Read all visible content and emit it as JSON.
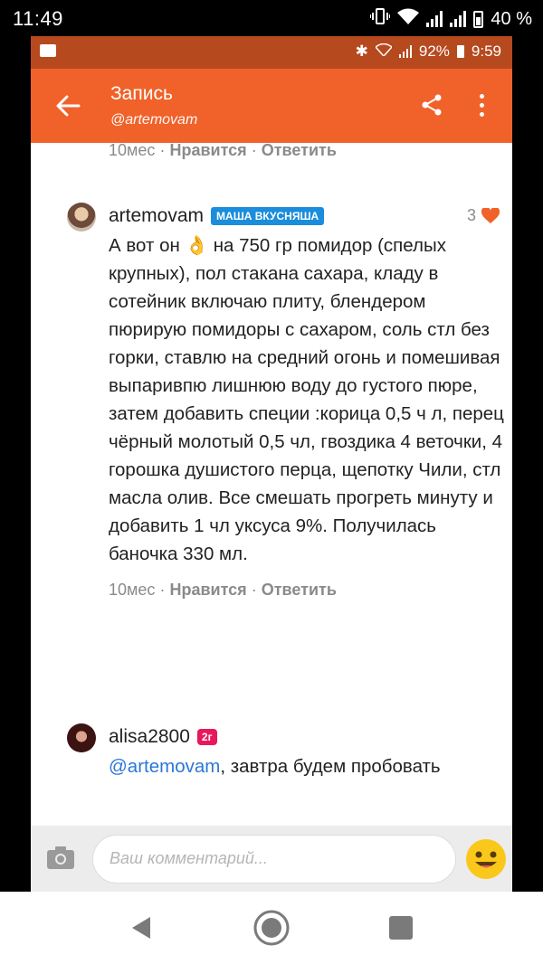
{
  "outer_status": {
    "time": "11:49",
    "battery": "40 %"
  },
  "inner_status": {
    "battery": "92%",
    "time": "9:59"
  },
  "appbar": {
    "title": "Запись",
    "subtitle": "@artemovam"
  },
  "top_meta": {
    "time": "10мес",
    "like_label": "Нравится",
    "reply_label": "Ответить",
    "separator": "·"
  },
  "comments": [
    {
      "author": "artemovam",
      "badge": "МАША ВКУСНЯША",
      "likes": "3",
      "text_before_emoji": "А вот он ",
      "text_after_emoji": " на 750 гр помидор (спелых крупных), пол стакана сахара, кладу в сотейник включаю плиту, блендером пюрирую помидоры с сахаром, соль стл без горки, ставлю на средний огонь и помешивая выпаривпю лишнюю воду до густого пюре, затем добавить специи :корица 0,5 ч л, перец чёрный молотый 0,5 чл, гвоздика 4 веточки, 4 горошка душистого перца, щепотку Чили, стл масла олив. Все смешать прогреть минуту и добавить 1 чл уксуса 9%. Получилась баночка 330 мл.",
      "meta_time": "10мес",
      "like_label": "Нравится",
      "reply_label": "Ответить",
      "separator": "·"
    },
    {
      "author": "alisa2800",
      "badge": "2г",
      "mention": "@artemovam",
      "text": ", завтра будем пробовать"
    }
  ],
  "comment_input": {
    "placeholder": "Ваш комментарий..."
  },
  "colors": {
    "accent": "#f0622a",
    "status_bar": "#b7491f",
    "link": "#2b77d9",
    "badge_blue": "#1a8ddb",
    "badge_pink": "#e8185b",
    "heart": "#f0622a"
  }
}
